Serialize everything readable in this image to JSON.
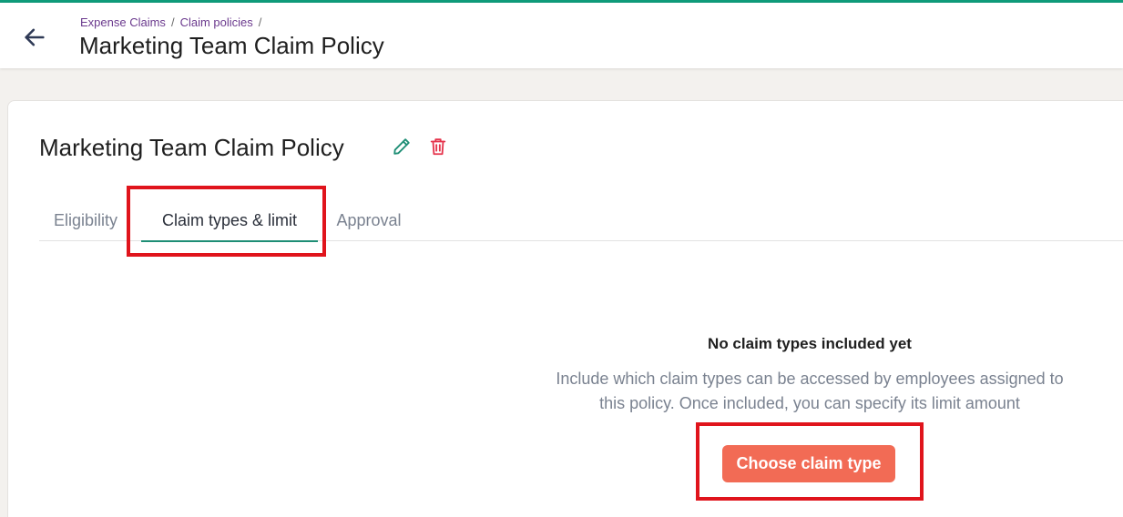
{
  "header": {
    "breadcrumb": [
      {
        "label": "Expense Claims"
      },
      {
        "label": "Claim policies"
      }
    ],
    "title": "Marketing Team Claim Policy"
  },
  "policy": {
    "title": "Marketing Team Claim Policy"
  },
  "tabs": [
    {
      "label": "Eligibility",
      "active": false
    },
    {
      "label": "Claim types & limit",
      "active": true
    },
    {
      "label": "Approval",
      "active": false
    }
  ],
  "empty_state": {
    "title": "No claim types included yet",
    "description_line1": "Include which claim types can be accessed by employees assigned to",
    "description_line2": "this policy. Once included, you can specify its limit amount",
    "button_label": "Choose claim type"
  },
  "icons": {
    "back": "arrow-left-icon",
    "edit": "pencil-icon",
    "delete": "trash-icon"
  },
  "colors": {
    "accent": "#0f9b7a",
    "primary_button": "#f26b55",
    "delete_icon": "#e5334b",
    "breadcrumb_link": "#6b3a8e",
    "highlight": "#e0141c"
  }
}
